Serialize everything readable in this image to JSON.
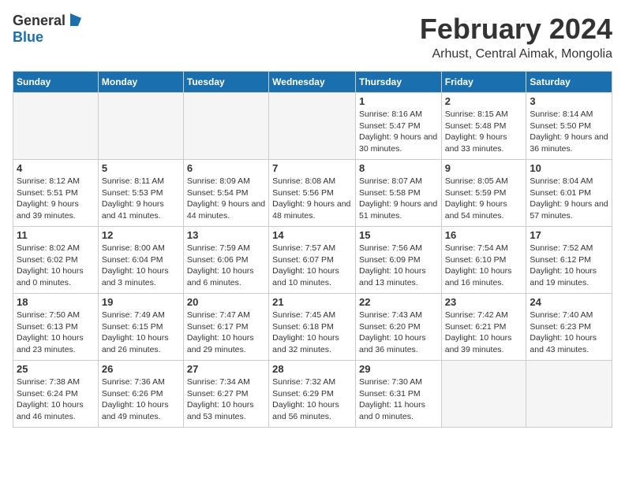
{
  "header": {
    "logo_general": "General",
    "logo_blue": "Blue",
    "month_title": "February 2024",
    "location": "Arhust, Central Aimak, Mongolia"
  },
  "days_of_week": [
    "Sunday",
    "Monday",
    "Tuesday",
    "Wednesday",
    "Thursday",
    "Friday",
    "Saturday"
  ],
  "weeks": [
    [
      {
        "day": "",
        "info": ""
      },
      {
        "day": "",
        "info": ""
      },
      {
        "day": "",
        "info": ""
      },
      {
        "day": "",
        "info": ""
      },
      {
        "day": "1",
        "info": "Sunrise: 8:16 AM\nSunset: 5:47 PM\nDaylight: 9 hours and 30 minutes."
      },
      {
        "day": "2",
        "info": "Sunrise: 8:15 AM\nSunset: 5:48 PM\nDaylight: 9 hours and 33 minutes."
      },
      {
        "day": "3",
        "info": "Sunrise: 8:14 AM\nSunset: 5:50 PM\nDaylight: 9 hours and 36 minutes."
      }
    ],
    [
      {
        "day": "4",
        "info": "Sunrise: 8:12 AM\nSunset: 5:51 PM\nDaylight: 9 hours and 39 minutes."
      },
      {
        "day": "5",
        "info": "Sunrise: 8:11 AM\nSunset: 5:53 PM\nDaylight: 9 hours and 41 minutes."
      },
      {
        "day": "6",
        "info": "Sunrise: 8:09 AM\nSunset: 5:54 PM\nDaylight: 9 hours and 44 minutes."
      },
      {
        "day": "7",
        "info": "Sunrise: 8:08 AM\nSunset: 5:56 PM\nDaylight: 9 hours and 48 minutes."
      },
      {
        "day": "8",
        "info": "Sunrise: 8:07 AM\nSunset: 5:58 PM\nDaylight: 9 hours and 51 minutes."
      },
      {
        "day": "9",
        "info": "Sunrise: 8:05 AM\nSunset: 5:59 PM\nDaylight: 9 hours and 54 minutes."
      },
      {
        "day": "10",
        "info": "Sunrise: 8:04 AM\nSunset: 6:01 PM\nDaylight: 9 hours and 57 minutes."
      }
    ],
    [
      {
        "day": "11",
        "info": "Sunrise: 8:02 AM\nSunset: 6:02 PM\nDaylight: 10 hours and 0 minutes."
      },
      {
        "day": "12",
        "info": "Sunrise: 8:00 AM\nSunset: 6:04 PM\nDaylight: 10 hours and 3 minutes."
      },
      {
        "day": "13",
        "info": "Sunrise: 7:59 AM\nSunset: 6:06 PM\nDaylight: 10 hours and 6 minutes."
      },
      {
        "day": "14",
        "info": "Sunrise: 7:57 AM\nSunset: 6:07 PM\nDaylight: 10 hours and 10 minutes."
      },
      {
        "day": "15",
        "info": "Sunrise: 7:56 AM\nSunset: 6:09 PM\nDaylight: 10 hours and 13 minutes."
      },
      {
        "day": "16",
        "info": "Sunrise: 7:54 AM\nSunset: 6:10 PM\nDaylight: 10 hours and 16 minutes."
      },
      {
        "day": "17",
        "info": "Sunrise: 7:52 AM\nSunset: 6:12 PM\nDaylight: 10 hours and 19 minutes."
      }
    ],
    [
      {
        "day": "18",
        "info": "Sunrise: 7:50 AM\nSunset: 6:13 PM\nDaylight: 10 hours and 23 minutes."
      },
      {
        "day": "19",
        "info": "Sunrise: 7:49 AM\nSunset: 6:15 PM\nDaylight: 10 hours and 26 minutes."
      },
      {
        "day": "20",
        "info": "Sunrise: 7:47 AM\nSunset: 6:17 PM\nDaylight: 10 hours and 29 minutes."
      },
      {
        "day": "21",
        "info": "Sunrise: 7:45 AM\nSunset: 6:18 PM\nDaylight: 10 hours and 32 minutes."
      },
      {
        "day": "22",
        "info": "Sunrise: 7:43 AM\nSunset: 6:20 PM\nDaylight: 10 hours and 36 minutes."
      },
      {
        "day": "23",
        "info": "Sunrise: 7:42 AM\nSunset: 6:21 PM\nDaylight: 10 hours and 39 minutes."
      },
      {
        "day": "24",
        "info": "Sunrise: 7:40 AM\nSunset: 6:23 PM\nDaylight: 10 hours and 43 minutes."
      }
    ],
    [
      {
        "day": "25",
        "info": "Sunrise: 7:38 AM\nSunset: 6:24 PM\nDaylight: 10 hours and 46 minutes."
      },
      {
        "day": "26",
        "info": "Sunrise: 7:36 AM\nSunset: 6:26 PM\nDaylight: 10 hours and 49 minutes."
      },
      {
        "day": "27",
        "info": "Sunrise: 7:34 AM\nSunset: 6:27 PM\nDaylight: 10 hours and 53 minutes."
      },
      {
        "day": "28",
        "info": "Sunrise: 7:32 AM\nSunset: 6:29 PM\nDaylight: 10 hours and 56 minutes."
      },
      {
        "day": "29",
        "info": "Sunrise: 7:30 AM\nSunset: 6:31 PM\nDaylight: 11 hours and 0 minutes."
      },
      {
        "day": "",
        "info": ""
      },
      {
        "day": "",
        "info": ""
      }
    ]
  ]
}
